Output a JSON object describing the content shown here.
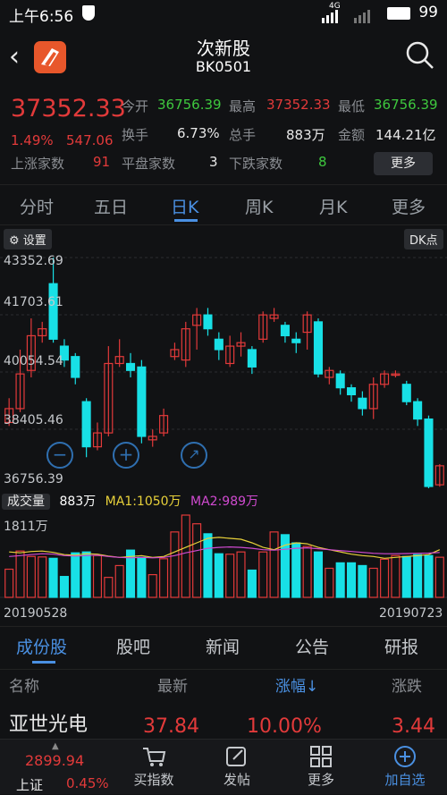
{
  "status_bar": {
    "time": "上午6:56",
    "network": "4G",
    "battery": "99"
  },
  "header": {
    "title": "次新股",
    "code": "BK0501"
  },
  "quote": {
    "price": "37352.33",
    "change_pct": "1.49%",
    "change": "547.06",
    "stats": {
      "open_label": "今开",
      "open_value": "36756.39",
      "high_label": "最高",
      "high_value": "37352.33",
      "low_label": "最低",
      "low_value": "36756.39",
      "turnover_label": "换手",
      "turnover_value": "6.73%",
      "volume_label": "总手",
      "volume_value": "883万",
      "amount_label": "金额",
      "amount_value": "144.21亿",
      "up_label": "上涨家数",
      "up_value": "91",
      "flat_label": "平盘家数",
      "flat_value": "3",
      "down_label": "下跌家数",
      "down_value": "8"
    },
    "more_label": "更多"
  },
  "chart_tabs": [
    "分时",
    "五日",
    "日K",
    "周K",
    "月K",
    "更多"
  ],
  "chart_controls": {
    "settings_label": "设置",
    "dk_label": "DK点"
  },
  "y_ticks": [
    "43352.69",
    "41703.61",
    "40054.54",
    "38405.46",
    "36756.39"
  ],
  "volume_legend": {
    "label": "成交量",
    "value": "883万",
    "ma1": "MA1:1050万",
    "ma2": "MA2:989万"
  },
  "vol_axis_top": "1811万",
  "dates": {
    "start": "20190528",
    "end": "20190723"
  },
  "lower_tabs": [
    "成份股",
    "股吧",
    "新闻",
    "公告",
    "研报"
  ],
  "list_header": {
    "name": "名称",
    "latest": "最新",
    "pct": "涨幅↓",
    "change": "涨跌"
  },
  "rows": [
    {
      "name": "亚世光电",
      "latest": "37.84",
      "pct": "10.00%",
      "change": "3.44"
    }
  ],
  "bottom_nav": {
    "index_value": "2899.94",
    "index_name": "上证",
    "index_pct": "0.45%",
    "buy_index": "买指数",
    "post": "发帖",
    "more": "更多",
    "add": "加自选"
  },
  "colors": {
    "up": "#e23a3a",
    "down": "#3ec83e",
    "accent": "#4a90e2",
    "candle_down_fill": "#18e0e6"
  },
  "chart_data": {
    "type": "candlestick",
    "ylim": [
      36756.39,
      43352.69
    ],
    "candles": [
      {
        "o": 38600,
        "c": 39000,
        "h": 39300,
        "l": 38500
      },
      {
        "o": 39000,
        "c": 40000,
        "h": 40700,
        "l": 38900
      },
      {
        "o": 40100,
        "c": 41100,
        "h": 41600,
        "l": 39900
      },
      {
        "o": 41100,
        "c": 41300,
        "h": 41500,
        "l": 40900
      },
      {
        "o": 42600,
        "c": 41000,
        "h": 43352.69,
        "l": 40900
      },
      {
        "o": 40800,
        "c": 40400,
        "h": 41000,
        "l": 40200
      },
      {
        "o": 40500,
        "c": 39900,
        "h": 40600,
        "l": 39700
      },
      {
        "o": 39200,
        "c": 37900,
        "h": 39300,
        "l": 37600
      },
      {
        "o": 37900,
        "c": 38300,
        "h": 38600,
        "l": 37800
      },
      {
        "o": 38300,
        "c": 40300,
        "h": 40800,
        "l": 38200
      },
      {
        "o": 40300,
        "c": 40500,
        "h": 41000,
        "l": 40200
      },
      {
        "o": 40300,
        "c": 40100,
        "h": 40600,
        "l": 39900
      },
      {
        "o": 40200,
        "c": 38200,
        "h": 40400,
        "l": 38000
      },
      {
        "o": 38100,
        "c": 38200,
        "h": 38400,
        "l": 37900
      },
      {
        "o": 38300,
        "c": 38800,
        "h": 39000,
        "l": 38200
      },
      {
        "o": 40500,
        "c": 40700,
        "h": 40900,
        "l": 40400
      },
      {
        "o": 40400,
        "c": 41300,
        "h": 41500,
        "l": 40200
      },
      {
        "o": 41400,
        "c": 41700,
        "h": 41900,
        "l": 40700
      },
      {
        "o": 41700,
        "c": 41300,
        "h": 41900,
        "l": 41100
      },
      {
        "o": 41000,
        "c": 40700,
        "h": 41200,
        "l": 40400
      },
      {
        "o": 40300,
        "c": 40800,
        "h": 41100,
        "l": 40200
      },
      {
        "o": 40800,
        "c": 40900,
        "h": 41200,
        "l": 40500
      },
      {
        "o": 40700,
        "c": 40200,
        "h": 40800,
        "l": 40000
      },
      {
        "o": 41000,
        "c": 41700,
        "h": 41800,
        "l": 40900
      },
      {
        "o": 41600,
        "c": 41700,
        "h": 41900,
        "l": 41500
      },
      {
        "o": 41400,
        "c": 41100,
        "h": 41500,
        "l": 40900
      },
      {
        "o": 41000,
        "c": 40900,
        "h": 41200,
        "l": 40600
      },
      {
        "o": 41200,
        "c": 41700,
        "h": 41800,
        "l": 40700
      },
      {
        "o": 41500,
        "c": 40000,
        "h": 41600,
        "l": 39900
      },
      {
        "o": 39900,
        "c": 40100,
        "h": 40200,
        "l": 39700
      },
      {
        "o": 40000,
        "c": 39600,
        "h": 40100,
        "l": 39400
      },
      {
        "o": 39600,
        "c": 39400,
        "h": 39700,
        "l": 39200
      },
      {
        "o": 39300,
        "c": 39000,
        "h": 39500,
        "l": 38800
      },
      {
        "o": 39000,
        "c": 39700,
        "h": 39900,
        "l": 38700
      },
      {
        "o": 39700,
        "c": 40000,
        "h": 40100,
        "l": 39600
      },
      {
        "o": 40000,
        "c": 40000,
        "h": 40100,
        "l": 39900
      },
      {
        "o": 39700,
        "c": 39200,
        "h": 39800,
        "l": 39100
      },
      {
        "o": 39200,
        "c": 38700,
        "h": 39300,
        "l": 38500
      },
      {
        "o": 38700,
        "c": 36756.39,
        "h": 38800,
        "l": 36700
      },
      {
        "o": 36805,
        "c": 37352.33,
        "h": 37400,
        "l": 36750
      }
    ],
    "volume": {
      "ylim": [
        0,
        1811
      ],
      "bars": [
        620,
        1020,
        900,
        890,
        860,
        460,
        980,
        1000,
        920,
        440,
        700,
        1040,
        880,
        500,
        850,
        1440,
        1811,
        1620,
        1400,
        960,
        950,
        1000,
        600,
        1000,
        1440,
        1380,
        1200,
        1120,
        1000,
        640,
        760,
        760,
        700,
        640,
        840,
        920,
        900,
        940,
        920,
        883
      ],
      "ma1": [
        1000,
        980,
        1010,
        1020,
        990,
        940,
        930,
        960,
        950,
        910,
        880,
        900,
        920,
        880,
        900,
        1000,
        1100,
        1200,
        1300,
        1320,
        1300,
        1280,
        1200,
        1100,
        1050,
        1150,
        1200,
        1180,
        1100,
        1050,
        1000,
        950,
        920,
        900,
        860,
        880,
        900,
        920,
        940,
        1050
      ],
      "ma2": [
        900,
        920,
        940,
        960,
        950,
        920,
        910,
        920,
        930,
        900,
        880,
        870,
        880,
        870,
        880,
        920,
        980,
        1030,
        1080,
        1100,
        1110,
        1100,
        1080,
        1050,
        1040,
        1060,
        1080,
        1090,
        1070,
        1050,
        1030,
        1010,
        990,
        970,
        960,
        960,
        965,
        970,
        975,
        989
      ]
    }
  }
}
